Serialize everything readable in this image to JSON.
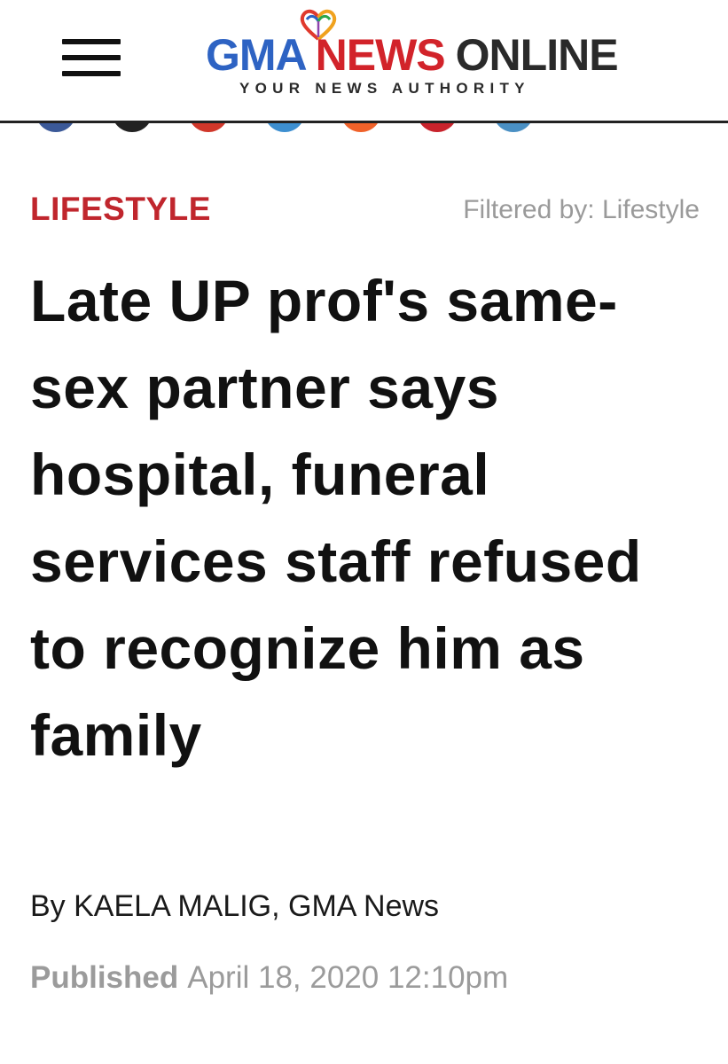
{
  "header": {
    "menu_icon": "hamburger-menu-icon",
    "logo": {
      "gma": "GMA",
      "news": "NEWS",
      "online": "ONLINE",
      "tagline": "YOUR NEWS AUTHORITY",
      "colors": {
        "gma": "#2e63c3",
        "news": "#d2232a",
        "online": "#2a2a2a"
      }
    }
  },
  "share_bar": {
    "icons": [
      {
        "name": "facebook-share-icon",
        "color": "#3b5998"
      },
      {
        "name": "messenger-share-icon",
        "color": "#222222"
      },
      {
        "name": "google-plus-share-icon",
        "color": "#d0372a"
      },
      {
        "name": "twitter-share-icon",
        "color": "#3d8fd0"
      },
      {
        "name": "reddit-share-icon",
        "color": "#f0622a"
      },
      {
        "name": "pinterest-share-icon",
        "color": "#c8232c"
      },
      {
        "name": "email-share-icon",
        "color": "#4a90c4"
      }
    ]
  },
  "article": {
    "section": "LIFESTYLE",
    "filter": "Filtered by: Lifestyle",
    "headline": "Late UP prof's same-sex partner says hospital, funeral services staff refused to recognize him as family",
    "byline": "By KAELA MALIG, GMA News",
    "published_label": "Published",
    "published_date": "April 18, 2020 12:10pm"
  },
  "colors": {
    "section_accent": "#c0262d",
    "muted_text": "#9b9b9b",
    "body_text": "#111111"
  }
}
